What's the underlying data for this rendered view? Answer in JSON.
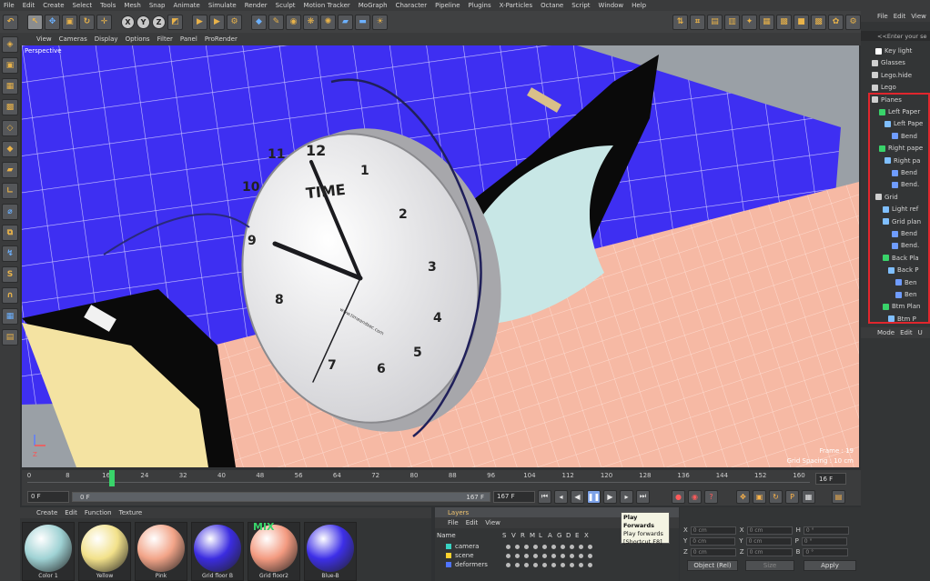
{
  "menu": [
    "File",
    "Edit",
    "Create",
    "Select",
    "Tools",
    "Mesh",
    "Snap",
    "Animate",
    "Simulate",
    "Render",
    "Sculpt",
    "Motion Tracker",
    "MoGraph",
    "Character",
    "Pipeline",
    "Plugins",
    "X-Particles",
    "Octane",
    "Script",
    "Window",
    "Help"
  ],
  "viewport_menu": [
    "View",
    "Cameras",
    "Display",
    "Options",
    "Filter",
    "Panel",
    "ProRender"
  ],
  "viewport": {
    "label": "Perspective",
    "frame": "Frame : 19",
    "grid_spacing": "Grid Spacing : 10 cm"
  },
  "clock": {
    "brand": "TIME",
    "small_text": "www.timeandsec.com",
    "numbers": [
      "12",
      "1",
      "2",
      "3",
      "4",
      "5",
      "6",
      "7",
      "8",
      "9",
      "10",
      "11"
    ]
  },
  "timeline": {
    "ticks": [
      "0",
      "8",
      "16",
      "24",
      "32",
      "40",
      "48",
      "56",
      "64",
      "72",
      "80",
      "88",
      "96",
      "104",
      "112",
      "120",
      "128",
      "136",
      "144",
      "152",
      "160"
    ],
    "end": "16 F",
    "start_field": "0 F",
    "range_start": "0 F",
    "range_end": "167 F",
    "range_end2": "167 F"
  },
  "transport_tooltip": {
    "line1": "Play Forwards",
    "line2": "Play forwards",
    "line3": "[Shortcut F8]"
  },
  "material_menu": [
    "Create",
    "Edit",
    "Function",
    "Texture"
  ],
  "materials": [
    {
      "name": "Color 1",
      "color": "#9fd2d4"
    },
    {
      "name": "Yellow",
      "color": "#f2e18a"
    },
    {
      "name": "Pink",
      "color": "#f2a488"
    },
    {
      "name": "Grid floor B",
      "color": "#3b2ce0"
    },
    {
      "name": "Grid floor2",
      "color": "#f39a80"
    },
    {
      "name": "Blue-B",
      "color": "#3d2fe8"
    }
  ],
  "mix_label": "MIX",
  "layers": {
    "title": "Layers",
    "menu": [
      "File",
      "Edit",
      "View"
    ],
    "header": [
      "Name",
      "S",
      "V",
      "R",
      "M",
      "L",
      "A",
      "G",
      "D",
      "E",
      "X"
    ],
    "rows": [
      {
        "name": "camera",
        "color": "#39d3c2"
      },
      {
        "name": "scene",
        "color": "#ffd22e"
      },
      {
        "name": "deformers",
        "color": "#4f74ff"
      }
    ]
  },
  "attributes": {
    "rows": [
      {
        "a": "X",
        "av": "0 cm",
        "b": "X",
        "bv": "0 cm",
        "c": "H",
        "cv": "0 °"
      },
      {
        "a": "Y",
        "av": "0 cm",
        "b": "Y",
        "bv": "0 cm",
        "c": "P",
        "cv": "0 °"
      },
      {
        "a": "Z",
        "av": "0 cm",
        "b": "Z",
        "bv": "0 cm",
        "c": "B",
        "cv": "0 °"
      }
    ],
    "dropdown1": "Object (Rel)",
    "dropdown2": "Size",
    "apply": "Apply"
  },
  "object_manager": {
    "menu": [
      "File",
      "Edit",
      "View"
    ],
    "search": "<<Enter your se",
    "items": [
      {
        "label": "Key light",
        "indent": 16,
        "color": "#ffffff"
      },
      {
        "label": "Glasses",
        "indent": 12,
        "color": "#cfcfcf"
      },
      {
        "label": "Lego.hide",
        "indent": 12,
        "color": "#cfcfcf"
      },
      {
        "label": "Lego",
        "indent": 12,
        "color": "#cfcfcf"
      },
      {
        "label": "Planes",
        "indent": 12,
        "color": "#cfcfcf"
      },
      {
        "label": "Left Paper",
        "indent": 20,
        "color": "#39d36a"
      },
      {
        "label": "Left Pape",
        "indent": 26,
        "color": "#7fbfff"
      },
      {
        "label": "Bend",
        "indent": 34,
        "color": "#6f9cff"
      },
      {
        "label": "Right pape",
        "indent": 20,
        "color": "#39d36a"
      },
      {
        "label": "Right pa",
        "indent": 26,
        "color": "#7fbfff"
      },
      {
        "label": "Bend",
        "indent": 34,
        "color": "#6f9cff"
      },
      {
        "label": "Bend.",
        "indent": 34,
        "color": "#6f9cff"
      },
      {
        "label": "Grid",
        "indent": 16,
        "color": "#cfcfcf"
      },
      {
        "label": "Light ref",
        "indent": 24,
        "color": "#7fbfff"
      },
      {
        "label": "Grid plan",
        "indent": 24,
        "color": "#7fbfff"
      },
      {
        "label": "Bend",
        "indent": 34,
        "color": "#6f9cff"
      },
      {
        "label": "Bend.",
        "indent": 34,
        "color": "#6f9cff"
      },
      {
        "label": "Back Pla",
        "indent": 24,
        "color": "#39d36a"
      },
      {
        "label": "Back P",
        "indent": 30,
        "color": "#7fbfff"
      },
      {
        "label": "Ben",
        "indent": 38,
        "color": "#6f9cff"
      },
      {
        "label": "Ben",
        "indent": 38,
        "color": "#6f9cff"
      },
      {
        "label": "Btm Plan",
        "indent": 24,
        "color": "#39d36a"
      },
      {
        "label": "Btm P",
        "indent": 30,
        "color": "#7fbfff"
      }
    ],
    "mode_menu": [
      "Mode",
      "Edit",
      "U"
    ]
  },
  "colors": {
    "accent_play": "#7da2e8",
    "highlight": "#e0262d",
    "timeline_cursor": "#39d36a"
  }
}
